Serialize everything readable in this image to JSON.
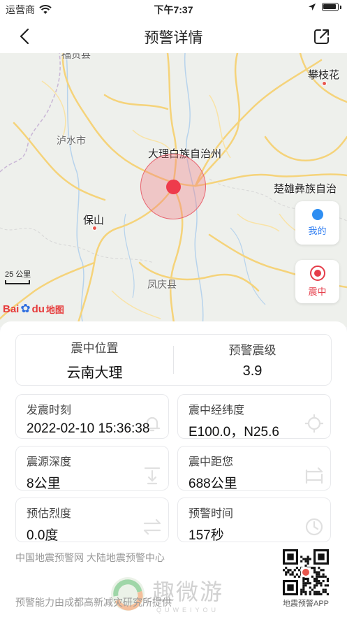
{
  "status_bar": {
    "carrier": "运营商",
    "time": "下午7:37"
  },
  "nav": {
    "title": "预警详情"
  },
  "map": {
    "labels": {
      "panzhihua": "攀枝花",
      "dali": "大理白族自治州",
      "lushui": "泸水市",
      "chuxiong": "楚雄彝族自治",
      "baoshan": "保山",
      "fengqing": "凤庆县",
      "top_partial": "福贡县"
    },
    "scale_label": "25 公里",
    "logo_text": "Bai",
    "logo_du": "du",
    "logo_map": "地图",
    "btn_mine": "我的",
    "btn_epicenter": "震中"
  },
  "summary": {
    "location_label": "震中位置",
    "location_value": "云南大理",
    "magnitude_label": "预警震级",
    "magnitude_value": "3.9"
  },
  "details": [
    {
      "label": "发震时刻",
      "value": "2022-02-10 15:36:38",
      "icon": "alarm-bell-icon"
    },
    {
      "label": "震中经纬度",
      "value": "E100.0，N25.6",
      "icon": "crosshair-icon"
    },
    {
      "label": "震源深度",
      "value": "8公里",
      "icon": "depth-arrow-icon"
    },
    {
      "label": "震中距您",
      "value": "688公里",
      "icon": "distance-icon"
    },
    {
      "label": "预估烈度",
      "value": "0.0度",
      "icon": "intensity-icon"
    },
    {
      "label": "预警时间",
      "value": "157秒",
      "icon": "clock-icon"
    }
  ],
  "footer": {
    "source": "中国地震预警网 大陆地震预警中心",
    "note": "预警能力由成都高新减灾研究所提供",
    "qr_caption": "地震预警APP"
  },
  "watermark": {
    "main": "趣微游",
    "sub": "QUWEIYOU"
  },
  "colors": {
    "epicenter": "#ee3b4c",
    "accent_blue": "#2e7df2",
    "road": "#f5d37a"
  }
}
